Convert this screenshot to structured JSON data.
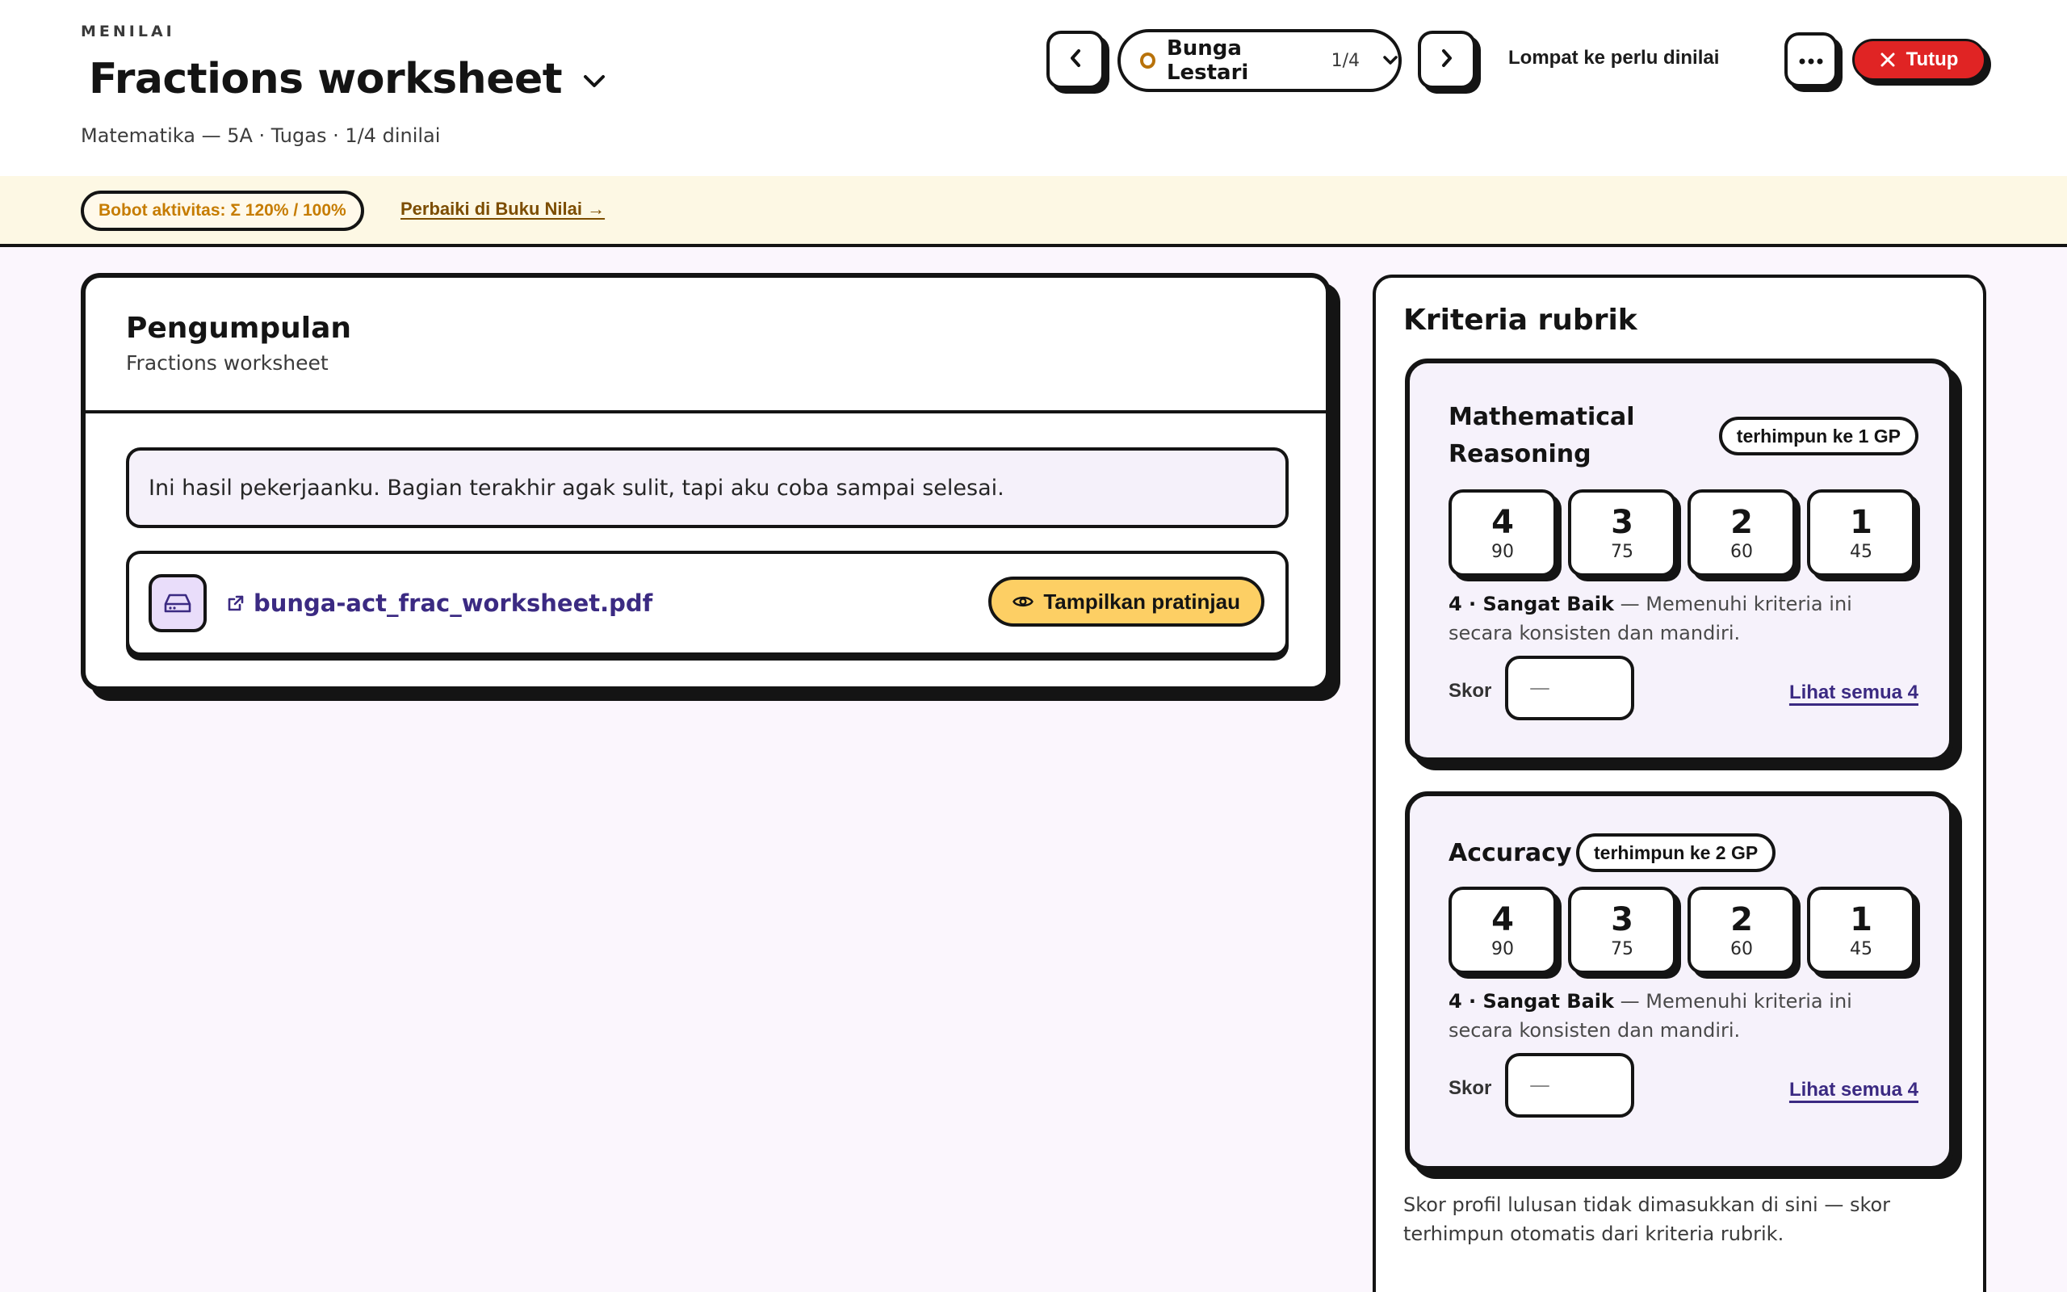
{
  "header": {
    "eyebrow": "MENILAI",
    "title": "Fractions worksheet",
    "subline": "Matematika — 5A · Tugas · 1/4 dinilai",
    "student": {
      "name": "Bunga Lestari",
      "count": "1/4"
    },
    "jump_label": "Lompat ke perlu dinilai",
    "close_label": "Tutup"
  },
  "warning": {
    "weight_badge": "Bobot aktivitas: Σ 120% / 100%",
    "fix_link": "Perbaiki di Buku Nilai →"
  },
  "submission": {
    "title": "Pengumpulan",
    "subtitle": "Fractions worksheet",
    "comment": "Ini hasil pekerjaanku. Bagian terakhir agak sulit, tapi aku coba sampai selesai.",
    "file_name": "bunga-act_frac_worksheet.pdf",
    "preview_label": "Tampilkan pratinjau"
  },
  "rubric": {
    "title": "Kriteria rubrik",
    "criteria": [
      {
        "name_line1": "Mathematical",
        "name_line2": "Reasoning",
        "gp_badge": "terhimpun ke 1 GP",
        "levels": [
          {
            "num": "4",
            "pts": "90"
          },
          {
            "num": "3",
            "pts": "75"
          },
          {
            "num": "2",
            "pts": "60"
          },
          {
            "num": "1",
            "pts": "45"
          }
        ],
        "desc_strong": "4 · Sangat Baik",
        "desc_text": " — Memenuhi kriteria ini secara konsisten dan mandiri.",
        "score_label": "Skor",
        "score_value": "—",
        "see_all": "Lihat semua 4"
      },
      {
        "name": "Accuracy",
        "gp_badge": "terhimpun ke 2 GP",
        "levels": [
          {
            "num": "4",
            "pts": "90"
          },
          {
            "num": "3",
            "pts": "75"
          },
          {
            "num": "2",
            "pts": "60"
          },
          {
            "num": "1",
            "pts": "45"
          }
        ],
        "desc_strong": "4 · Sangat Baik",
        "desc_text": " — Memenuhi kriteria ini secara konsisten dan mandiri.",
        "score_label": "Skor",
        "score_value": "—",
        "see_all": "Lihat semua 4"
      }
    ],
    "footnote": "Skor profil lulusan tidak dimasukkan di sini — skor terhimpun otomatis dari kriteria rubrik."
  },
  "colors": {
    "accent_link": "#3b2a82",
    "close_red": "#e02424",
    "preview_yellow": "#fdcf64",
    "warning_orange": "#c67c00",
    "status_ring": "#b8720a"
  },
  "icons": [
    "chevron-down-icon",
    "chevron-left-icon",
    "chevron-right-icon",
    "more-icon",
    "close-icon",
    "hard-drive-icon",
    "external-link-icon",
    "eye-icon"
  ]
}
